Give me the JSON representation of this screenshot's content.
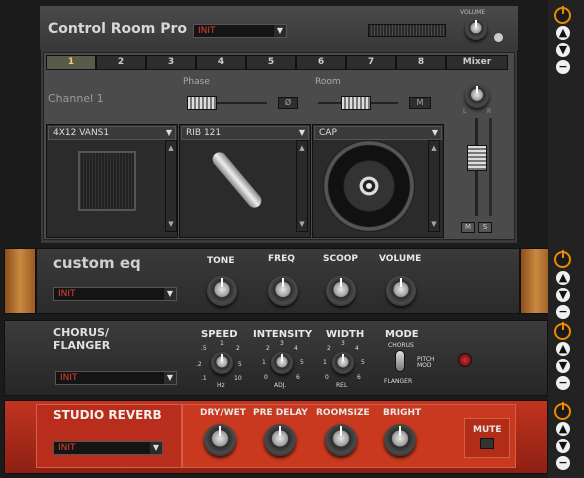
{
  "colors": {
    "accent": "#e88b00",
    "preset_text": "#e04030",
    "reverb_bg": "#c0321e"
  },
  "control_room": {
    "title": "Control Room Pro",
    "preset": "INIT",
    "volume_label": "VOLUME",
    "tabs": [
      "1",
      "2",
      "3",
      "4",
      "5",
      "6",
      "7",
      "8",
      "Mixer"
    ],
    "active_tab": "1",
    "channel_label": "Channel 1",
    "phase_label": "Phase",
    "phase_button": "Ø",
    "room_label": "Room",
    "room_button": "M",
    "cabinet": "4X12 VANS1",
    "mic": "RIB 121",
    "mic_position": "CAP",
    "pan_l": "L",
    "pan_r": "R",
    "mute_button": "M",
    "solo_button": "S"
  },
  "custom_eq": {
    "title": "custom eq",
    "preset": "INIT",
    "knobs": [
      "TONE",
      "FREQ",
      "SCOOP",
      "VOLUME"
    ]
  },
  "chorus": {
    "title_line1": "CHORUS/",
    "title_line2": "FLANGER",
    "preset": "INIT",
    "speed_label": "SPEED",
    "speed_unit": "Hz",
    "speed_scale": [
      ".5",
      "1",
      "2",
      ".2",
      "5",
      ".1",
      "10"
    ],
    "intensity_label": "INTENSITY",
    "intensity_unit": "ADJ.",
    "intensity_scale": [
      "2",
      "3",
      "4",
      "1",
      "5",
      "0",
      "6"
    ],
    "width_label": "WIDTH",
    "width_unit": "REL",
    "width_scale": [
      "2",
      "3",
      "4",
      "1",
      "5",
      "0",
      "6"
    ],
    "mode_label": "MODE",
    "mode_options": [
      "CHORUS",
      "PITCH MOD",
      "FLANGER"
    ]
  },
  "studio_reverb": {
    "title": "STUDIO REVERB",
    "preset": "INIT",
    "knobs": [
      "DRY/WET",
      "PRE DELAY",
      "ROOMSIZE",
      "BRIGHT"
    ],
    "mute_label": "MUTE"
  },
  "side_controls": {
    "up": "▲",
    "down": "▼",
    "remove": "−"
  }
}
